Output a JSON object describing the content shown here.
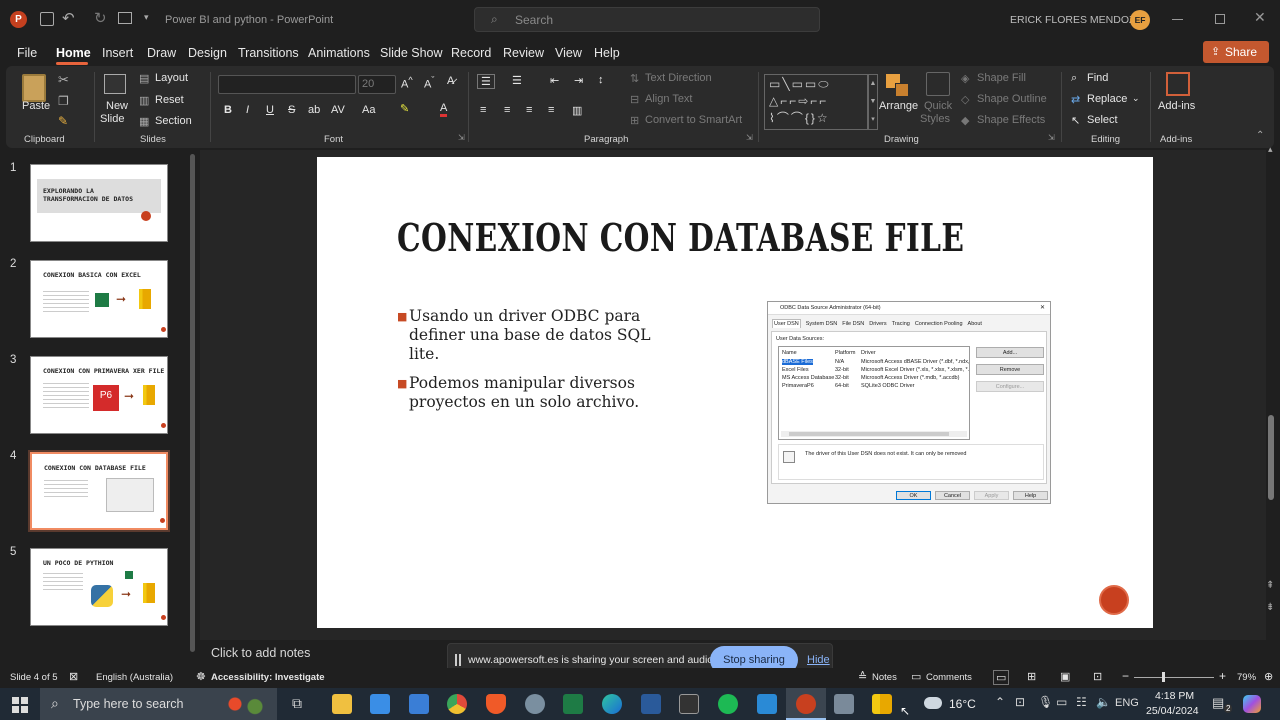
{
  "title_bar": {
    "app_logo": "P",
    "doc_title": "Power BI and python  -  PowerPoint",
    "search_placeholder": "Search",
    "user_name": "ERICK FLORES MENDOZA",
    "user_initials": "EF"
  },
  "menu": [
    "File",
    "Home",
    "Insert",
    "Draw",
    "Design",
    "Transitions",
    "Animations",
    "Slide Show",
    "Record",
    "Review",
    "View",
    "Help"
  ],
  "share_label": "Share",
  "ribbon": {
    "clipboard": {
      "label": "Clipboard",
      "paste": "Paste"
    },
    "slides": {
      "label": "Slides",
      "new_slide_1": "New",
      "new_slide_2": "Slide",
      "layout": "Layout",
      "reset": "Reset",
      "section": "Section"
    },
    "font": {
      "label": "Font",
      "font_name": "",
      "font_size": "20",
      "bold": "B",
      "italic": "I",
      "underline": "U",
      "strike": "S",
      "font_color": "A"
    },
    "paragraph": {
      "label": "Paragraph",
      "text_direction": "Text Direction",
      "align_text": "Align Text",
      "convert": "Convert to SmartArt"
    },
    "drawing": {
      "label": "Drawing",
      "arrange": "Arrange",
      "quick_styles_1": "Quick",
      "quick_styles_2": "Styles",
      "shape_fill": "Shape Fill",
      "shape_outline": "Shape Outline",
      "shape_effects": "Shape Effects"
    },
    "editing": {
      "label": "Editing",
      "find": "Find",
      "replace": "Replace",
      "select": "Select"
    },
    "addins": {
      "label": "Add-ins",
      "addins_btn": "Add-ins"
    }
  },
  "thumbnails": [
    {
      "num": "1",
      "title": "EXPLORANDO LA\nTRANSFORMACION DE DATOS"
    },
    {
      "num": "2",
      "title": "CONEXION BASICA CON EXCEL"
    },
    {
      "num": "3",
      "title": "CONEXION CON PRIMAVERA XER FILE"
    },
    {
      "num": "4",
      "title": "CONEXION CON DATABASE FILE"
    },
    {
      "num": "5",
      "title": "UN POCO DE PYTHION"
    }
  ],
  "slide": {
    "title": "CONEXION CON DATABASE FILE",
    "bullets": [
      "Usando un driver ODBC para definer una base de datos SQL lite.",
      "Podemos manipular diversos proyectos en un solo archivo."
    ],
    "odbc": {
      "window_title": "ODBC Data Source Administrator (64-bit)",
      "tabs": [
        "User DSN",
        "System DSN",
        "File DSN",
        "Drivers",
        "Tracing",
        "Connection Pooling",
        "About"
      ],
      "section": "User Data Sources:",
      "columns": [
        "Name",
        "Platform",
        "Driver"
      ],
      "rows": [
        [
          "dBASE Files",
          "N/A",
          "Microsoft Access dBASE Driver (*.dbf, *.ndx, *.m"
        ],
        [
          "Excel Files",
          "32-bit",
          "Microsoft Excel Driver (*.xls, *.xlsx, *.xlsm, *.xlsb)"
        ],
        [
          "MS Access Database",
          "32-bit",
          "Microsoft Access Driver (*.mdb, *.accdb)"
        ],
        [
          "PrimaveraP6",
          "64-bit",
          "SQLite3 ODBC Driver"
        ]
      ],
      "buttons": [
        "Add...",
        "Remove",
        "Configure..."
      ],
      "info": "The driver of this User DSN does not exist. It can only be removed",
      "footer_buttons": [
        "OK",
        "Cancel",
        "Apply",
        "Help"
      ]
    }
  },
  "notes_placeholder": "Click to add notes",
  "share_banner": {
    "text": "www.apowersoft.es is sharing your screen and audio.",
    "stop": "Stop sharing",
    "hide": "Hide"
  },
  "status": {
    "slide_of": "Slide 4 of 5",
    "language": "English (Australia)",
    "accessibility": "Accessibility: Investigate",
    "notes": "Notes",
    "comments": "Comments",
    "zoom": "79%"
  },
  "taskbar": {
    "search_placeholder": "Type here to search",
    "weather": "16°C",
    "lang": "ENG",
    "time": "4:18 PM",
    "date": "25/04/2024",
    "notif_count": "2"
  }
}
